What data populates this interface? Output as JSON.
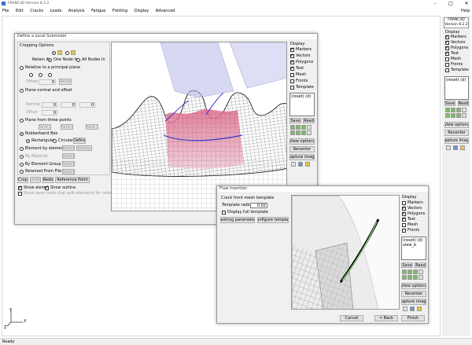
{
  "app": {
    "title": "FRANC3D Version 8.2.2",
    "menu": [
      "File",
      "Edit",
      "Cracks",
      "Loads",
      "Analysis",
      "Fatigue",
      "Fretting",
      "Display",
      "Advanced"
    ],
    "help": "Help",
    "status": "Ready"
  },
  "right_panel": {
    "title_line1": "FRANC3D",
    "title_line2": "Version 8.2.2",
    "display_label": "Display",
    "checks": [
      {
        "label": "Markers",
        "checked": true
      },
      {
        "label": "Vectors",
        "checked": true
      },
      {
        "label": "Polygons",
        "checked": true
      },
      {
        "label": "Text",
        "checked": true
      },
      {
        "label": "Mesh",
        "checked": false
      },
      {
        "label": "Fronts",
        "checked": false
      },
      {
        "label": "Template",
        "checked": false
      }
    ],
    "list_items": [
      "(reset) (d)"
    ],
    "save": "Save",
    "read": "Read",
    "view_options": "View options",
    "recenter": "Recenter",
    "capture_image": "Capture image"
  },
  "submodel": {
    "title": "Define a Local Submodel",
    "cropping_options": "Cropping Options",
    "retain_if": "Retain if:",
    "one_node_in": "One Node In",
    "all_nodes_in": "All Nodes In",
    "relative_principal": "Relative to a principal plane",
    "offset_label": "Offset",
    "offset_value": "0",
    "reset": "Reset",
    "plane_normal": "Plane normal and offset",
    "normal_label": "Normal",
    "normal_values": [
      "0",
      "0",
      "0"
    ],
    "offset2_label": "Offset",
    "offset2_value": "0",
    "plane_three_points": "Plane from three points",
    "point1": "Point 1",
    "point2": "Point 2",
    "point3": "Point 3",
    "rubberband": "Rubberband Box",
    "rectangular": "Rectangular",
    "circular": "Circular",
    "define": "Define",
    "element_by_element": "Element by element",
    "select": "Select",
    "deselect": "Deselect",
    "by_material": "By Material",
    "by_element_group": "By Element Group",
    "retained_from_file": "Retained From File",
    "from_file": "Select",
    "crop": "Crop",
    "undo": "Undo",
    "redo": "Redo",
    "reference_point": "Reference Point",
    "show_elems": "Show elems",
    "show_outline": "Show outline",
    "show_open_tools": "Show open tools that split elements for reference",
    "display_label": "Display",
    "checks": [
      {
        "label": "Markers",
        "checked": true
      },
      {
        "label": "Vectors",
        "checked": true
      },
      {
        "label": "Polygons",
        "checked": true
      },
      {
        "label": "Text",
        "checked": true
      },
      {
        "label": "Mesh",
        "checked": false
      },
      {
        "label": "Fronts",
        "checked": false
      },
      {
        "label": "Template",
        "checked": false
      }
    ],
    "list_items": [
      "(reset) (d)"
    ],
    "save": "Save",
    "read": "Read",
    "view_options": "View options",
    "recenter": "Recenter",
    "capture_image": "Capture image"
  },
  "flaw": {
    "title": "Flaw Insertion",
    "crack_from_template": "Crack front mesh template",
    "template_radius": "Template radius",
    "template_radius_value": "0.02",
    "display_full_template": "Display full template",
    "meshing_parameters": "Meshing parameters",
    "configure_template": "Configure template",
    "display_label": "Display",
    "checks": [
      {
        "label": "Markers",
        "checked": false
      },
      {
        "label": "Vectors",
        "checked": true
      },
      {
        "label": "Polygons",
        "checked": true
      },
      {
        "label": "Text",
        "checked": true
      },
      {
        "label": "Mesh",
        "checked": false
      },
      {
        "label": "Fronts",
        "checked": false
      }
    ],
    "list_items": [
      "(reset) (d)",
      "view_b"
    ],
    "save": "Save",
    "read": "Read",
    "view_options": "View options",
    "recenter": "Recenter",
    "capture_image": "Capture image",
    "cancel": "Cancel",
    "back": "< Back",
    "finish": "Finish"
  },
  "axes": {
    "y": "Y",
    "x": "X",
    "z": "Z"
  }
}
